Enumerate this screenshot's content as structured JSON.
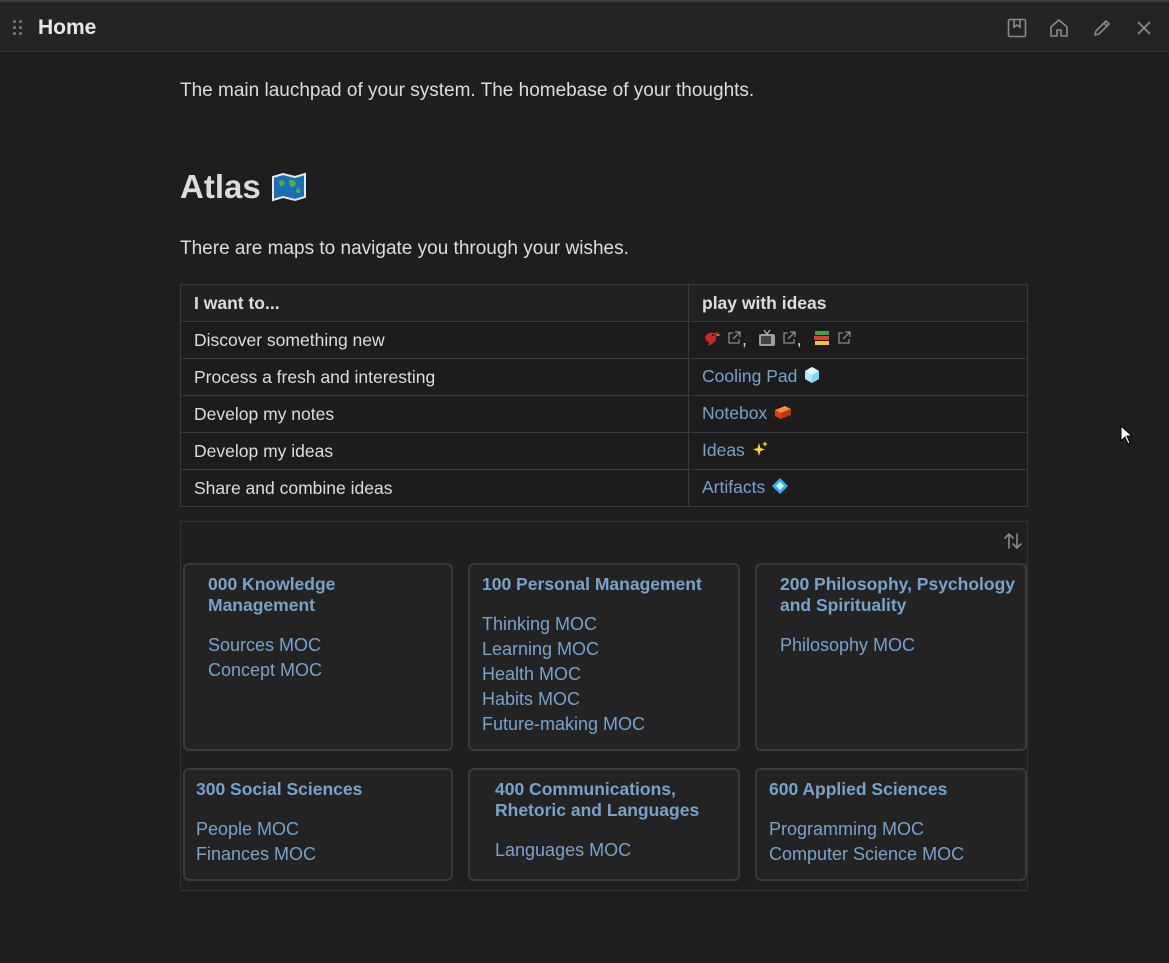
{
  "titlebar": {
    "title": "Home",
    "icons": [
      "bookmark-icon",
      "home-icon",
      "edit-icon",
      "close-icon"
    ]
  },
  "intro": "The main lauchpad of your system. The homebase of your thoughts.",
  "atlas": {
    "heading": "Atlas",
    "heading_icon": "map-emoji",
    "subtitle": "There are maps to navigate you through your wishes."
  },
  "table": {
    "headers": [
      "I want to...",
      "play with ideas"
    ],
    "rows": [
      {
        "want": "Discover something new",
        "action": "",
        "icons": [
          "bird-emoji",
          "tv-emoji",
          "books-emoji"
        ]
      },
      {
        "want": "Process a fresh and interesting",
        "action": "Cooling Pad",
        "icon": "ice-cube-emoji"
      },
      {
        "want": "Develop my notes",
        "action": "Notebox",
        "icon": "brick-emoji"
      },
      {
        "want": "Develop my ideas",
        "action": "Ideas",
        "icon": "sparkles-emoji"
      },
      {
        "want": "Share and combine ideas",
        "action": "Artifacts",
        "icon": "diamond-emoji"
      }
    ],
    "separator": ","
  },
  "cards": [
    {
      "title": "000 Knowledge Management",
      "title_lines": [
        "000 Knowledge",
        "Management"
      ],
      "links": [
        "Sources MOC",
        "Concept MOC"
      ]
    },
    {
      "title": "100 Personal Management",
      "title_lines": [
        "100 Personal Management"
      ],
      "links": [
        "Thinking MOC",
        "Learning MOC",
        "Health MOC",
        "Habits MOC",
        "Future-making MOC"
      ]
    },
    {
      "title": "200 Philosophy, Psychology and Spirituality",
      "title_lines": [
        "200 Philosophy, Psychology",
        "and Spirituality"
      ],
      "links": [
        "Philosophy MOC"
      ]
    },
    {
      "title": "300 Social Sciences",
      "title_lines": [
        "300 Social Sciences"
      ],
      "links": [
        "People MOC",
        "Finances MOC"
      ]
    },
    {
      "title": "400 Communications, Rhetoric and Languages",
      "title_lines": [
        "400 Communications,",
        "Rhetoric and Languages"
      ],
      "links": [
        "Languages MOC"
      ]
    },
    {
      "title": "600 Applied Sciences",
      "title_lines": [
        "600 Applied Sciences"
      ],
      "links": [
        "Programming MOC",
        "Computer Science MOC"
      ]
    }
  ],
  "colors": {
    "background": "#1e1e1e",
    "link": "#7aa2c8",
    "text": "#dcddde",
    "border": "#3a3a3a"
  }
}
